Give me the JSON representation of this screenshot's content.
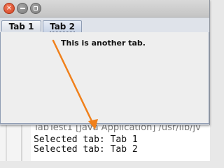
{
  "console": {
    "title": "TabTest1 [Java Application] /usr/lib/jv",
    "lines": [
      "Selected tab: Tab 1",
      "Selected tab: Tab 2"
    ]
  },
  "window": {
    "buttons": {
      "close": "×"
    },
    "tabs": [
      {
        "label": "Tab 1",
        "selected": false
      },
      {
        "label": "Tab 2",
        "selected": true
      }
    ],
    "content_text": "This is another tab."
  },
  "colors": {
    "arrow": "#f0801b",
    "close_button": "#e0532f"
  },
  "icons": {
    "close": "close-icon",
    "minimize": "minimize-icon",
    "maximize": "maximize-icon"
  }
}
